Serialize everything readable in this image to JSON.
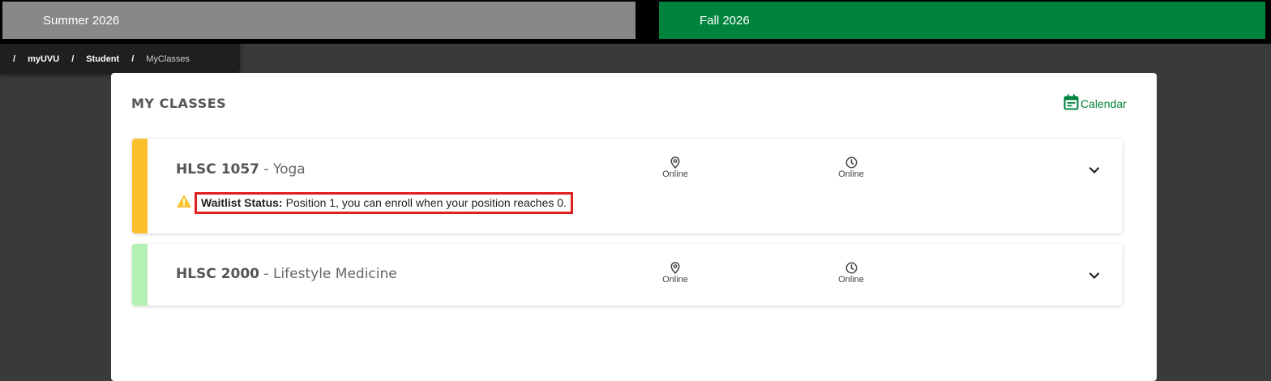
{
  "terms": {
    "summer": "Summer 2026",
    "fall": "Fall 2026"
  },
  "breadcrumb": {
    "items": [
      "myUVU",
      "Student",
      "MyClasses"
    ],
    "separator": "/"
  },
  "page": {
    "title": "MY CLASSES",
    "calendar_label": "Calendar"
  },
  "classes": [
    {
      "code": "HLSC 1057",
      "dash": "-",
      "name": "Yoga",
      "location": "Online",
      "time": "Online",
      "stripe_color": "#fbc02d",
      "waitlist": {
        "label": "Waitlist Status:",
        "message": "Position 1, you can enroll when your position reaches 0."
      }
    },
    {
      "code": "HLSC 2000",
      "dash": "-",
      "name": "Lifestyle Medicine",
      "location": "Online",
      "time": "Online",
      "stripe_color": "#b3f0b3"
    }
  ],
  "colors": {
    "accent": "#00843d",
    "warning": "#fbc02d",
    "highlight_border": "#e02020"
  },
  "icons": {
    "calendar": "calendar-icon",
    "location": "map-pin-icon",
    "time": "clock-icon",
    "expand": "chevron-down-icon",
    "warning": "warning-icon"
  }
}
